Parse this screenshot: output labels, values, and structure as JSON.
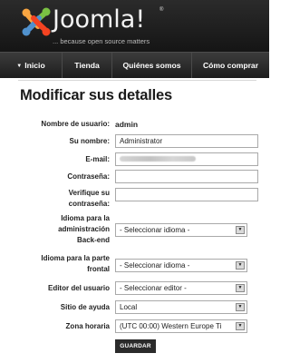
{
  "header": {
    "logo_text": "Joomla!",
    "tm": "®",
    "tagline": "... because open source matters"
  },
  "nav": {
    "items": [
      {
        "label": "Inicio",
        "active": true
      },
      {
        "label": "Tienda"
      },
      {
        "label": "Quiénes somos"
      },
      {
        "label": "Cómo comprar"
      }
    ]
  },
  "page": {
    "title": "Modificar sus detalles"
  },
  "form": {
    "username_label": "Nombre de usuario:",
    "username_value": "admin",
    "name_label": "Su nombre:",
    "name_value": "Administrator",
    "email_label": "E-mail:",
    "password_label": "Contraseña:",
    "verify_label_line1": "Verifique su",
    "verify_label_line2": "contraseña:",
    "admin_lang_line1": "Idioma para la",
    "admin_lang_line2": "administración",
    "admin_lang_line3": "Back-end",
    "admin_lang_value": "- Seleccionar idioma -",
    "front_lang_line1": "Idioma para la parte",
    "front_lang_line2": "frontal",
    "front_lang_value": "- Seleccionar idioma -",
    "editor_label": "Editor del usuario",
    "editor_value": "- Seleccionar editor -",
    "help_label": "Sitio de ayuda",
    "help_value": "Local",
    "timezone_label": "Zona horaria",
    "timezone_value": "(UTC 00:00) Western Europe Ti",
    "save_label": "GUARDAR"
  },
  "colors": {
    "header_bg": "#1f1f1f",
    "logo_orange": "#f9a541",
    "logo_red": "#f44321",
    "logo_blue": "#5091cd",
    "logo_green": "#7ac143"
  }
}
